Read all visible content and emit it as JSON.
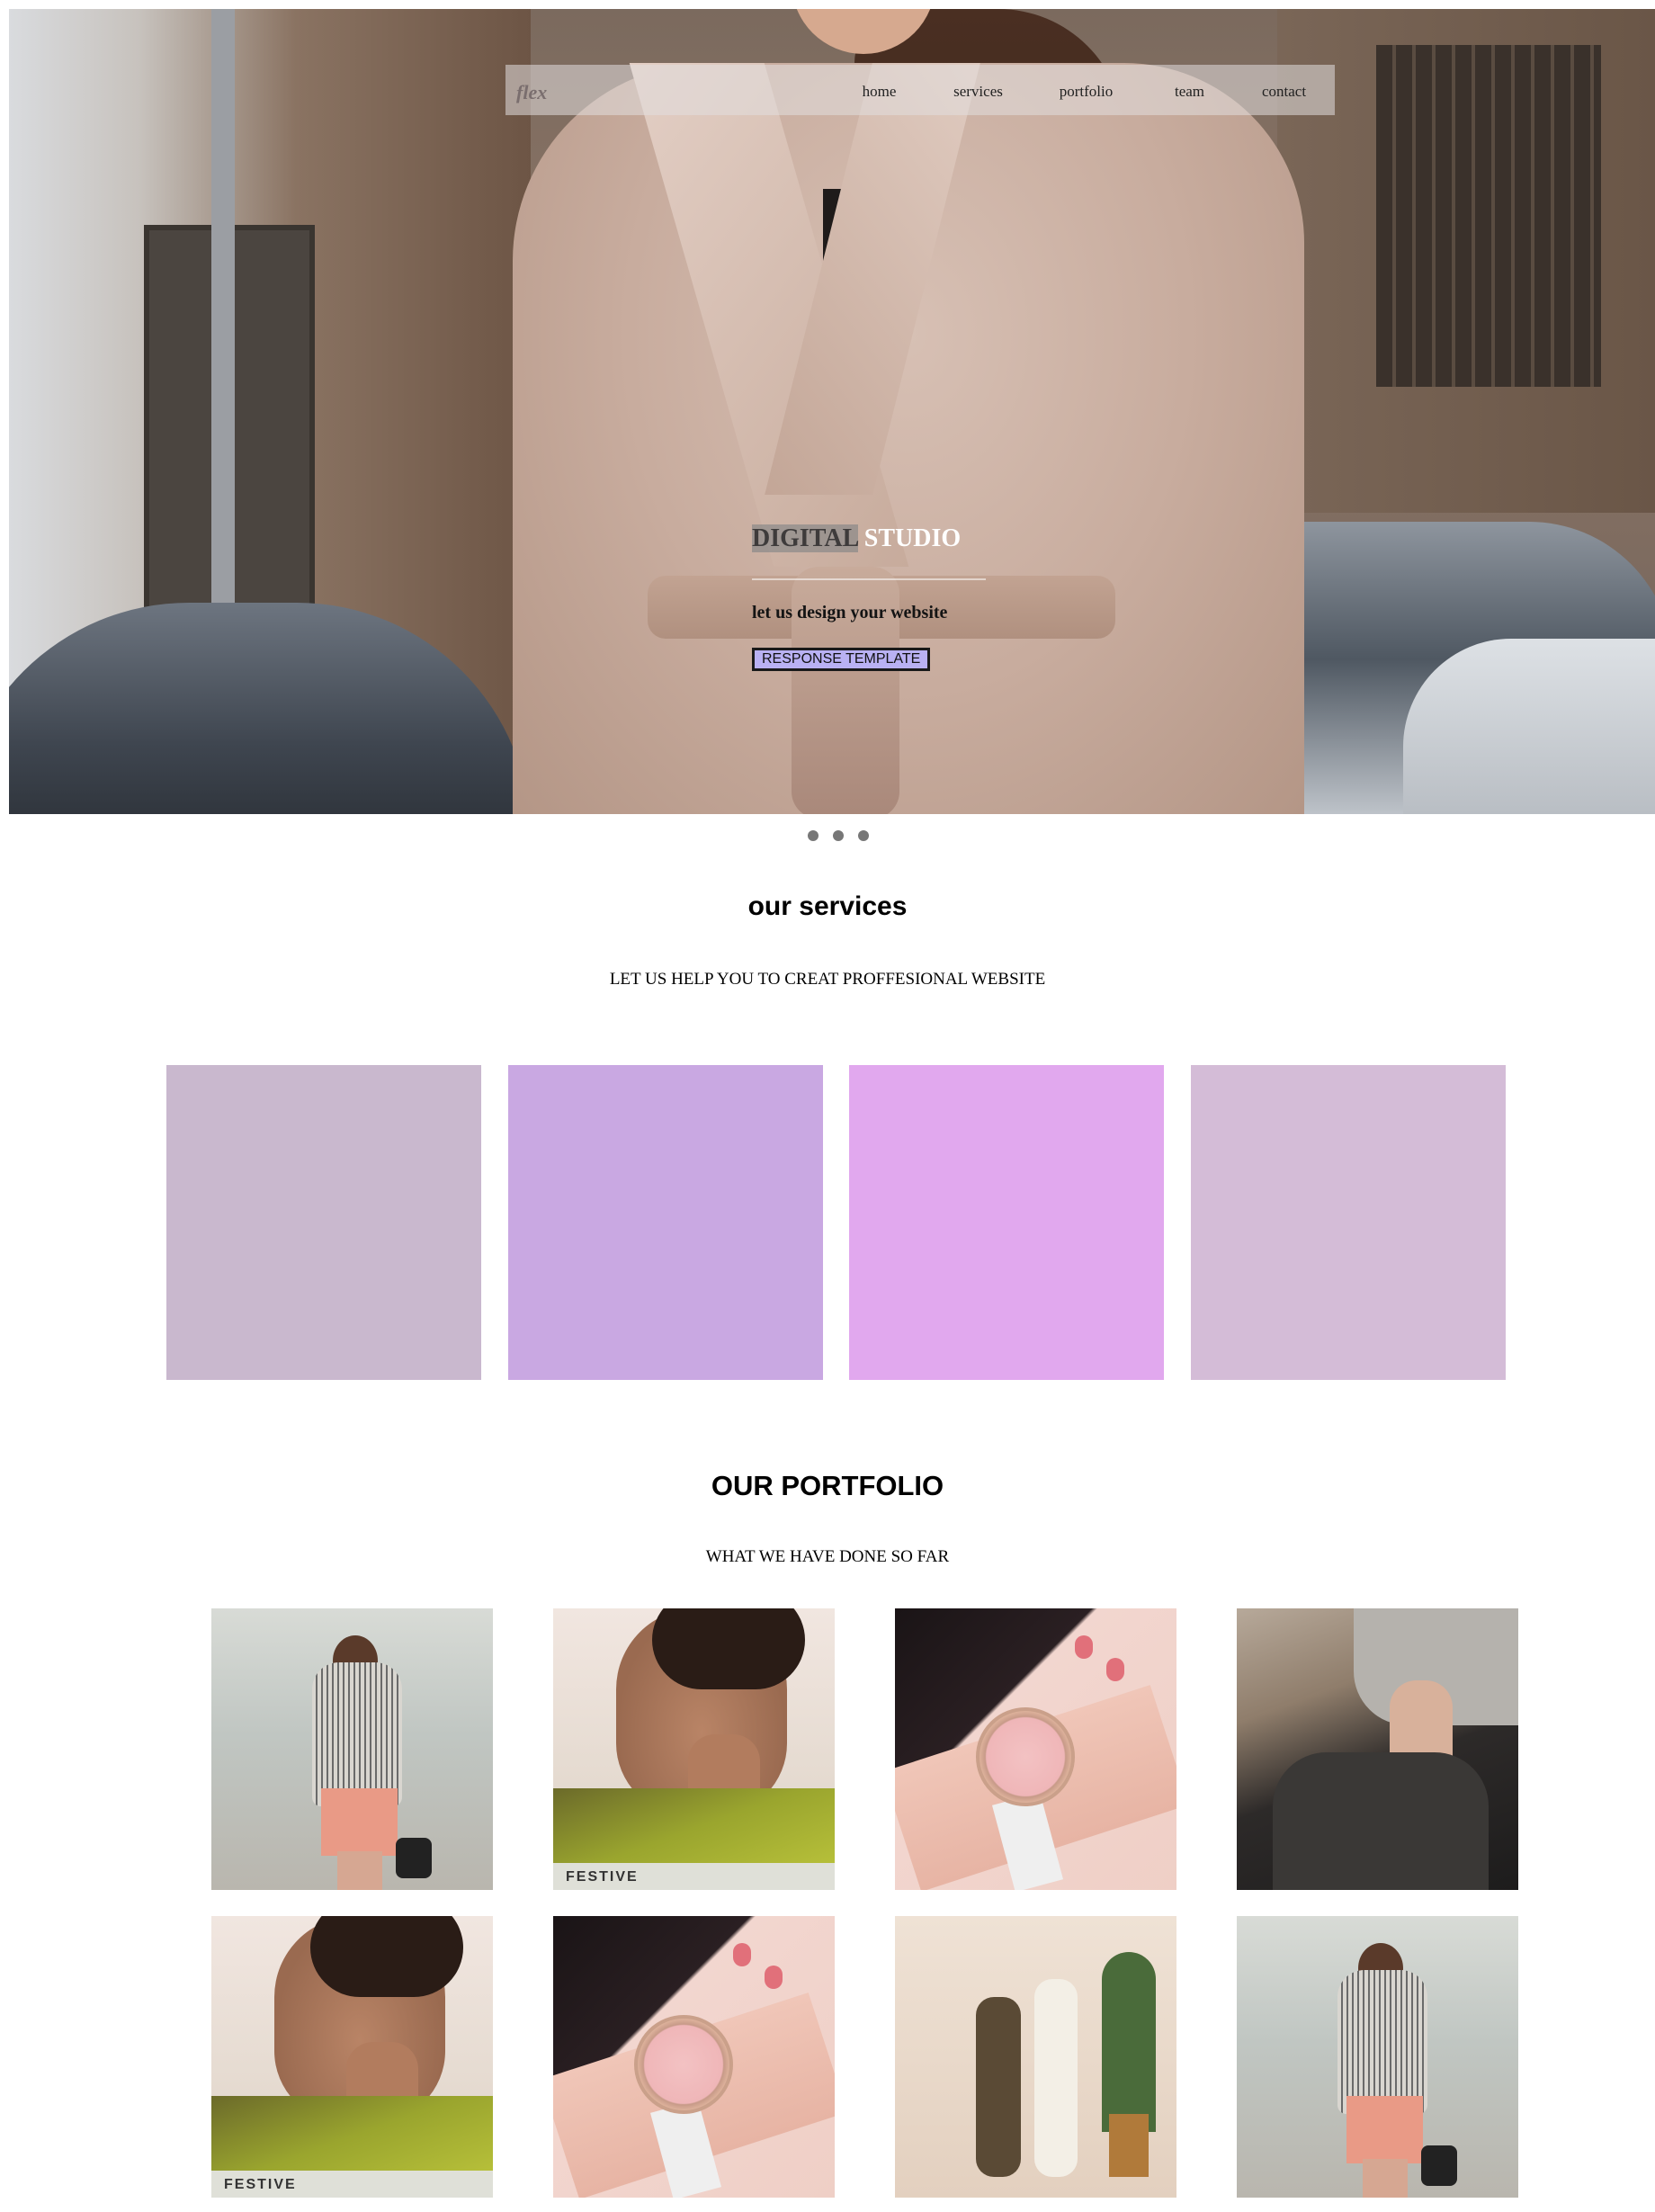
{
  "nav": {
    "logo": "flex",
    "links": [
      "home",
      "services",
      "portfolio",
      "team",
      "contact"
    ]
  },
  "hero": {
    "title_part1": "DIGITAL",
    "title_part2": " STUDIO",
    "subtitle": "let us design your website",
    "button_label": "RESPONSE TEMPLATE"
  },
  "slider": {
    "dot_count": 3
  },
  "services": {
    "title": "our services",
    "subtitle": "LET US HELP YOU TO CREAT PROFFESIONAL WEBSITE",
    "box_colors": [
      "#c9b8ce",
      "#c9a8e2",
      "#e1a8ee",
      "#d4bcd7"
    ]
  },
  "portfolio": {
    "title": "OUR PORTFOLIO",
    "subtitle": "WHAT WE HAVE DONE SO FAR",
    "festive_tag": "FESTIVE"
  }
}
